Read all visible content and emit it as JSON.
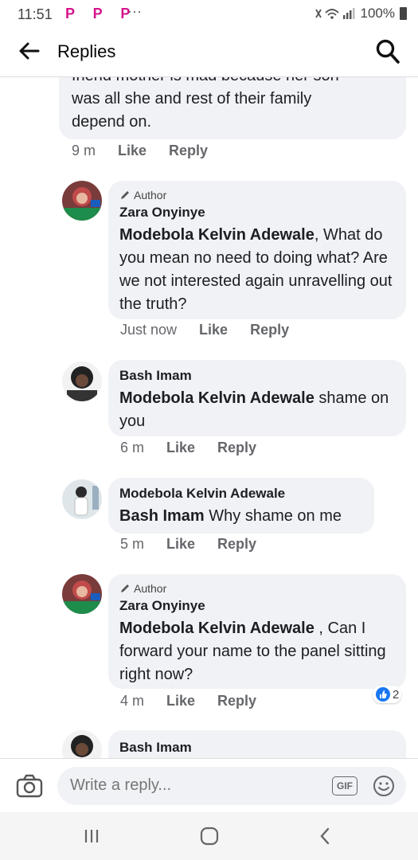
{
  "status": {
    "time": "11:51",
    "notif": "P P P",
    "more": "···",
    "battery": "100%"
  },
  "header": {
    "title": "Replies"
  },
  "comments": [
    {
      "lines": [
        "friend mother is mad because her son",
        "was all she and rest of their family",
        "depend on."
      ],
      "time": "9 m",
      "like": "Like",
      "reply": "Reply"
    },
    {
      "badge": "Author",
      "name": "Zara Onyinye",
      "mention": "Modebola Kelvin Adewale",
      "text": ", What do you mean no need to doing what? Are we not interested again unravelling out the truth?",
      "time": "Just now",
      "like": "Like",
      "reply": "Reply"
    },
    {
      "name": "Bash Imam",
      "mention": "Modebola Kelvin Adewale",
      "text": " shame on you",
      "time": "6 m",
      "like": "Like",
      "reply": "Reply"
    },
    {
      "name": "Modebola Kelvin Adewale",
      "mention": "Bash Imam",
      "text": " Why shame on me",
      "time": "5 m",
      "like": "Like",
      "reply": "Reply"
    },
    {
      "badge": "Author",
      "name": "Zara Onyinye",
      "mention": "Modebola Kelvin Adewale",
      "text": " , Can I forward your name to the panel sitting right now?",
      "time": "4 m",
      "like": "Like",
      "reply": "Reply",
      "reactions": "2"
    },
    {
      "name": "Bash Imam"
    }
  ],
  "composer": {
    "placeholder": "Write a reply...",
    "gif": "GIF"
  },
  "colors": {
    "accent": "#1877f2",
    "notif": "#d5148c",
    "bubble": "#f0f2f5"
  }
}
